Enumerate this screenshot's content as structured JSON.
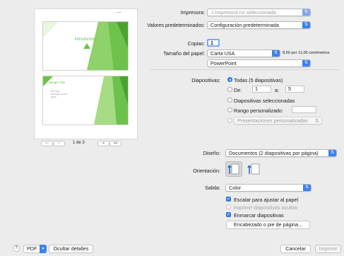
{
  "preview": {
    "dash": "—",
    "slide1_title": "Introduction",
    "slide2_title": "Weight Tips",
    "slide2_bullets": [
      "Start slowly",
      "Add weight over time",
      "Stretch"
    ],
    "slide_number": "2",
    "nav_first": "<<",
    "nav_prev": "<",
    "page_indicator": "1 de 3",
    "nav_next": ">",
    "nav_last": ">>"
  },
  "printer": {
    "label": "Impresora:",
    "value": "⚠Impresora no seleccionada"
  },
  "presets": {
    "label": "Valores predeterminados:",
    "value": "Configuración predeterminada"
  },
  "copies": {
    "label": "Copias:",
    "value": "1"
  },
  "paper_size": {
    "label": "Tamaño del papel:",
    "value": "Carta USA",
    "dimensions": "8,50 por 11,00 centímetros"
  },
  "app_section": {
    "value": "PowerPoint"
  },
  "slides": {
    "label": "Diapositivas:",
    "option_all": "Todas (5 diapositivas)",
    "from_label": "De:",
    "from_value": "1",
    "to_label": "a:",
    "to_value": "5",
    "option_selected": "Diapositivas seleccionadas",
    "option_custom": "Rango personalizado:",
    "custom_value": "",
    "custom_shows": "Presentaciones personalizadas"
  },
  "layout": {
    "label": "Diseño:",
    "value": "Documentos (2 diapositivas por página)"
  },
  "orientation": {
    "label": "Orientación:"
  },
  "output": {
    "label": "Salida:",
    "value": "Color"
  },
  "options": {
    "scale_to_fit": "Escalar para ajustar al papel",
    "print_hidden": "Imprimir diapositivas ocultas",
    "frame_slides": "Enmarcar diapositivas",
    "header_footer_button": "Encabezado o pie de página..."
  },
  "footer": {
    "help": "?",
    "pdf": "PDF",
    "hide_details": "Ocultar detalles",
    "cancel": "Cancelar",
    "print": "Imprimir"
  },
  "colors": {
    "accent": "#3b82f0",
    "slide_green": "#6cc24a",
    "window_bg": "#ececec"
  }
}
